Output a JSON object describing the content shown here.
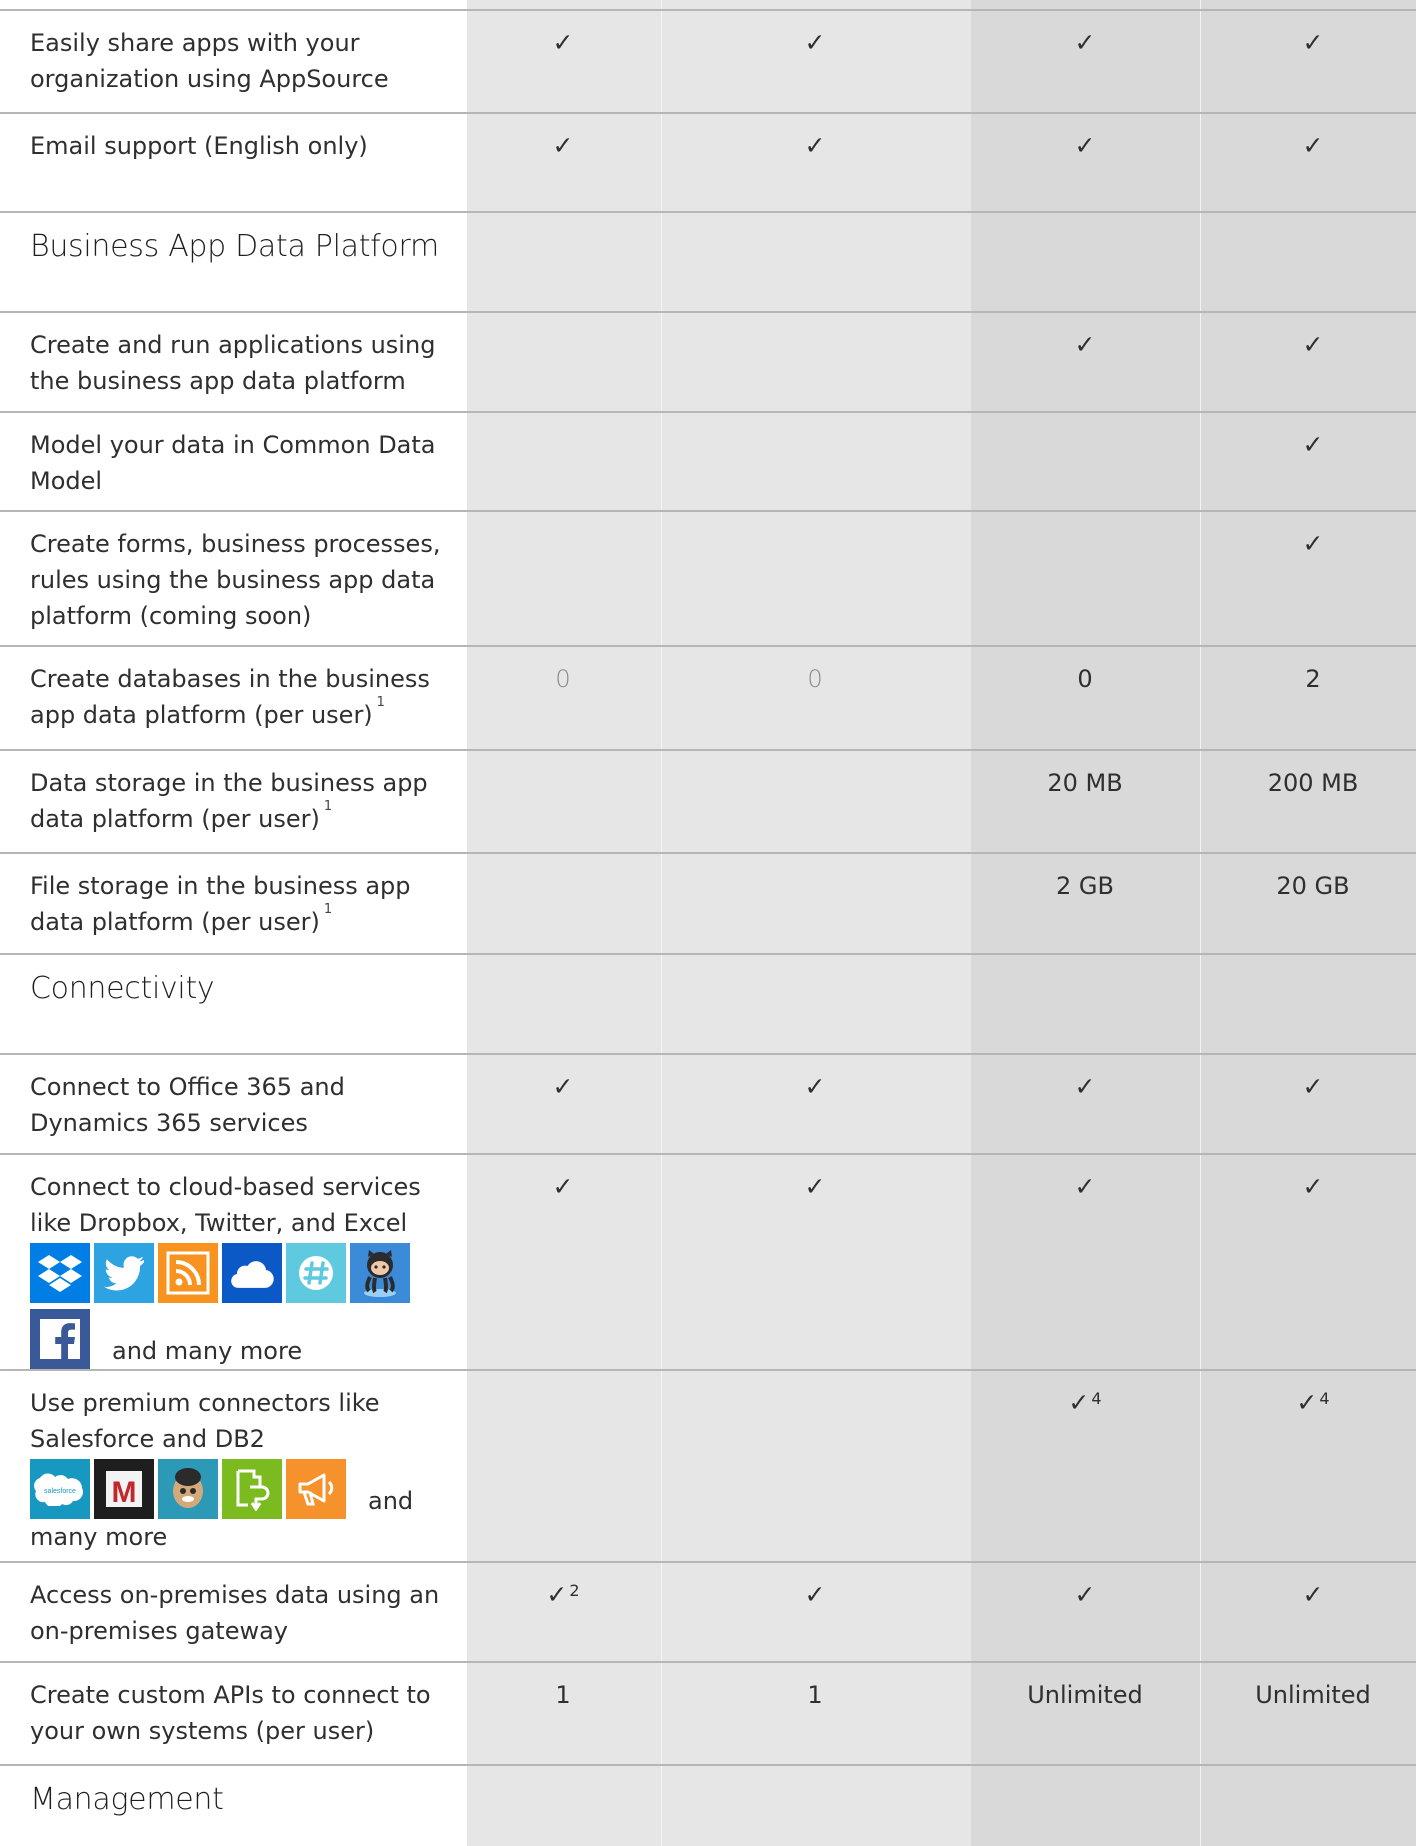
{
  "colors": {
    "band_light": "#e6e6e6",
    "band_dark": "#d9d9d9",
    "row_border": "#b6b6b6",
    "text": "#2f2f2f"
  },
  "rows": [
    {
      "type": "feature",
      "label": "Easily share apps with your organization using AppSource",
      "c1": "✓",
      "c2": "✓",
      "c3": "✓",
      "c4": "✓"
    },
    {
      "type": "feature",
      "label": "Email support (English only)",
      "c1": "✓",
      "c2": "✓",
      "c3": "✓",
      "c4": "✓"
    },
    {
      "type": "section",
      "label": "Business App Data Platform"
    },
    {
      "type": "feature",
      "label": "Create and run applications using the business app data platform",
      "c3": "✓",
      "c4": "✓"
    },
    {
      "type": "feature",
      "label": "Model your data in Common Data Model",
      "c4": "✓"
    },
    {
      "type": "feature",
      "label": "Create forms, business processes, rules using the business app data platform (coming soon)",
      "c4": "✓"
    },
    {
      "type": "feature",
      "label": "Create databases in the business app data platform (per user)",
      "footnote": "1",
      "c1": "0",
      "c2": "0",
      "c3": "0",
      "c4": "2"
    },
    {
      "type": "feature",
      "label": "Data storage in the business app data platform (per user)",
      "footnote": "1",
      "c3": "20 MB",
      "c4": "200 MB"
    },
    {
      "type": "feature",
      "label": "File storage in the business app data platform (per user)",
      "footnote": "1",
      "c3": "2 GB",
      "c4": "20 GB"
    },
    {
      "type": "section",
      "label": "Connectivity"
    },
    {
      "type": "feature",
      "label": "Connect to Office 365 and Dynamics 365 services",
      "c1": "✓",
      "c2": "✓",
      "c3": "✓",
      "c4": "✓"
    },
    {
      "type": "feature",
      "label": "Connect to cloud-based services like Dropbox, Twitter, and Excel",
      "tail": "and many more",
      "icons": [
        "dropbox-icon",
        "twitter-icon",
        "rss-icon",
        "onedrive-icon",
        "slack-icon",
        "github-icon",
        "facebook-icon"
      ],
      "c1": "✓",
      "c2": "✓",
      "c3": "✓",
      "c4": "✓"
    },
    {
      "type": "feature",
      "label": "Use premium connectors like Salesforce and DB2",
      "tail_a": "and",
      "tail_b": "many more",
      "icons": [
        "salesforce-icon",
        "marketo-icon",
        "mailchimp-icon",
        "docs-export-icon",
        "campaign-icon"
      ],
      "c3": "✓",
      "c3_sup": "4",
      "c4": "✓",
      "c4_sup": "4"
    },
    {
      "type": "feature",
      "label": "Access on-premises data using an on-premises gateway",
      "c1": "✓",
      "c1_sup": "2",
      "c2": "✓",
      "c3": "✓",
      "c4": "✓"
    },
    {
      "type": "feature",
      "label": "Create custom APIs to connect to your own systems (per user)",
      "c1": "1",
      "c2": "1",
      "c3": "Unlimited",
      "c4": "Unlimited"
    },
    {
      "type": "section",
      "label": "Management"
    }
  ],
  "icon_text": {
    "salesforce": "salesforce",
    "marketo": "M",
    "facebook": "f"
  }
}
